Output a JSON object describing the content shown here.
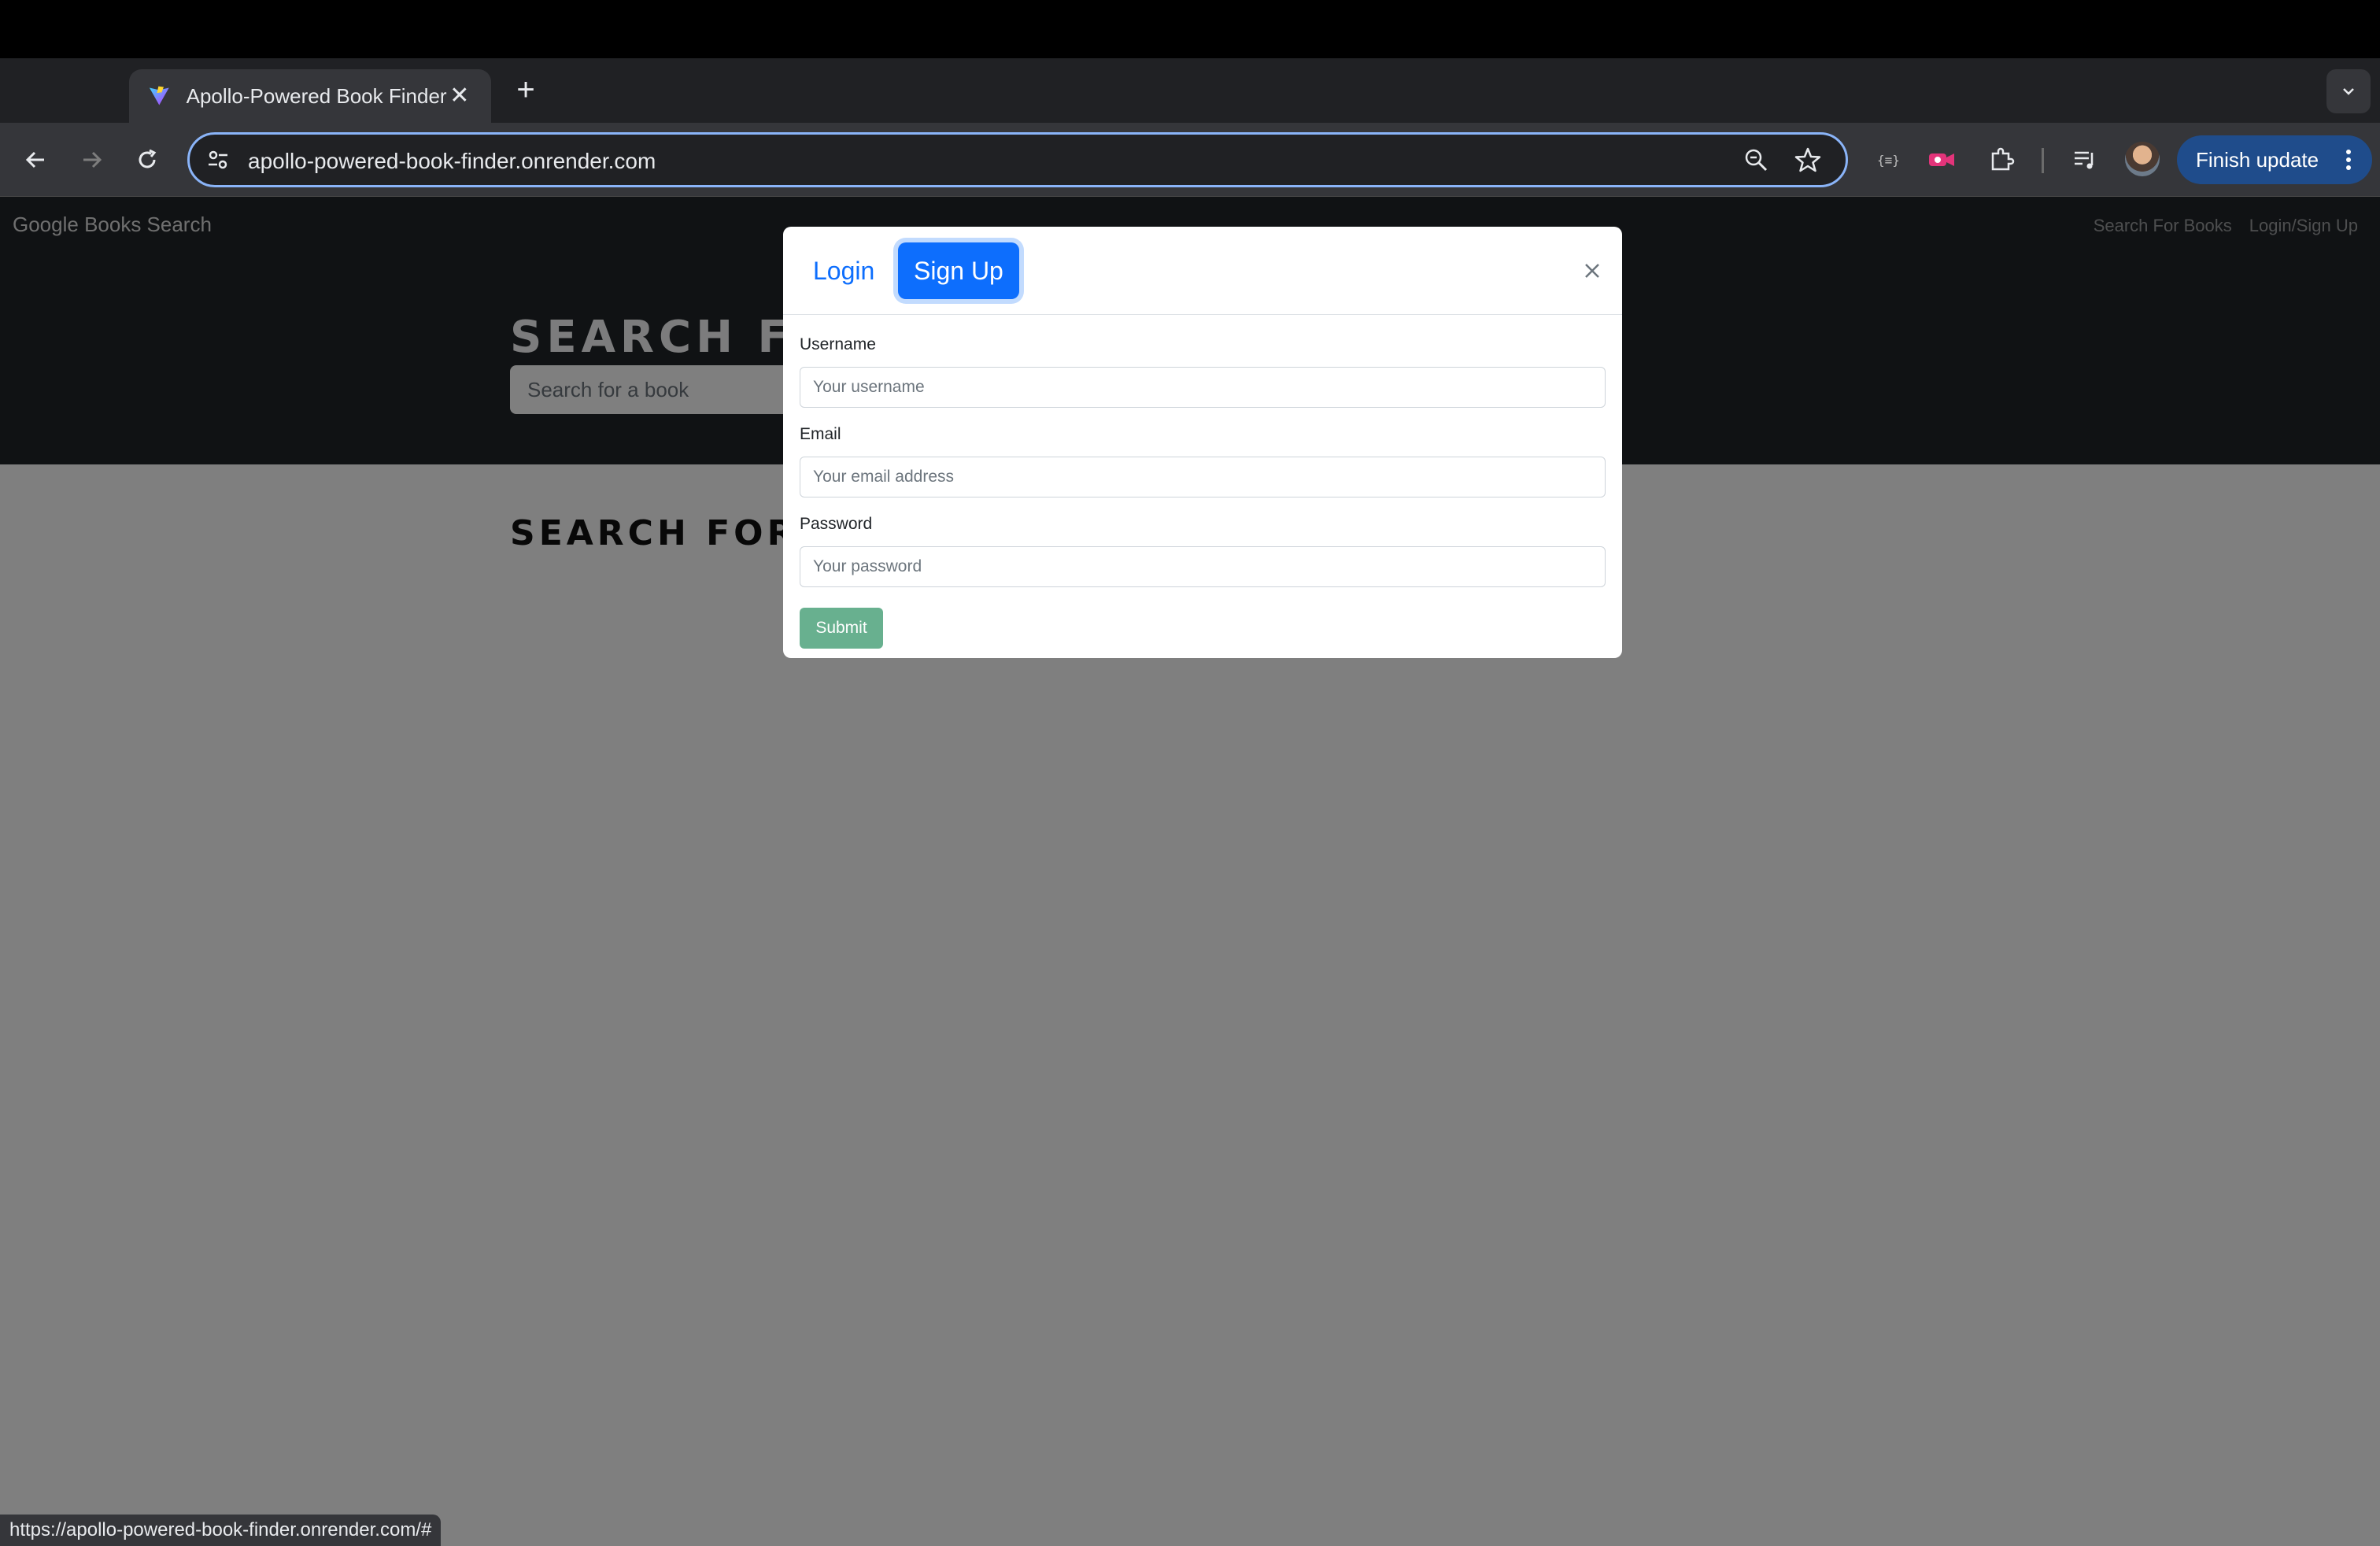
{
  "browser": {
    "tab_title": "Apollo-Powered Book Finder",
    "tab_close": "✕",
    "new_tab": "+",
    "url": "apollo-powered-book-finder.onrender.com",
    "finish_update": "Finish update",
    "status_url": "https://apollo-powered-book-finder.onrender.com/#",
    "accent": "#8ab4f8"
  },
  "site": {
    "brand": "Google Books Search",
    "nav": [
      "Search For Books",
      "Login/Sign Up"
    ],
    "hero_title": "SEARCH  FOR BOOKS!",
    "search_placeholder": "Search for a book",
    "results_title": "SEARCH  FOR A BOOK TO BEGIN"
  },
  "modal": {
    "tabs": [
      "Login",
      "Sign Up"
    ],
    "active_tab": "Sign Up",
    "fields": [
      {
        "label": "Username",
        "placeholder": "Your username"
      },
      {
        "label": "Email",
        "placeholder": "Your email address"
      },
      {
        "label": "Password",
        "placeholder": "Your password"
      }
    ],
    "submit_label": "Submit",
    "primary_color": "#0d6efd",
    "submit_color": "#198754"
  }
}
